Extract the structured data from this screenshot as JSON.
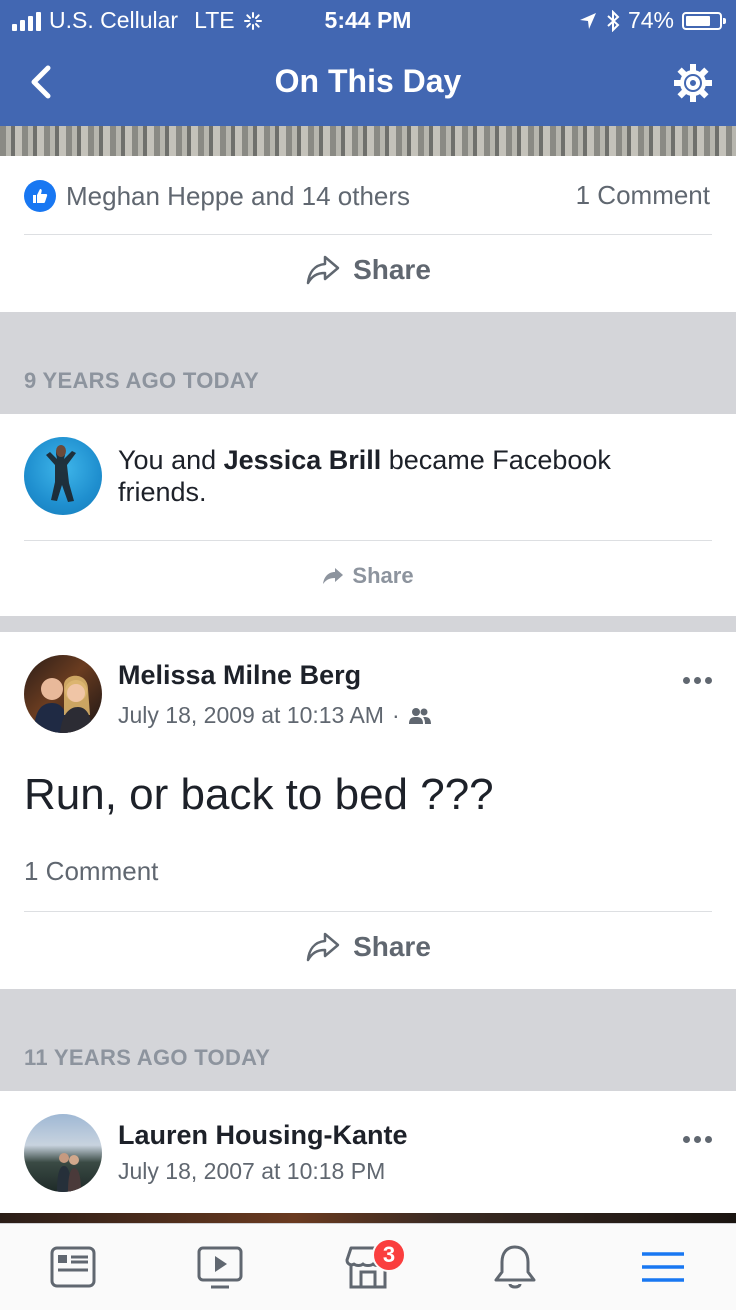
{
  "status_bar": {
    "carrier": "U.S. Cellular",
    "network": "LTE",
    "time": "5:44 PM",
    "battery_percent": "74%",
    "battery_level": 0.74
  },
  "navbar": {
    "title": "On This Day",
    "back_icon": "chevron-left-icon",
    "settings_icon": "gear-icon"
  },
  "post_top": {
    "reactions_text": "Meghan Heppe and 14 others",
    "comments": "1 Comment",
    "share_label": "Share"
  },
  "section_9_years": {
    "header": "9 YEARS AGO TODAY",
    "friend_prefix": "You and ",
    "friend_name": "Jessica Brill",
    "friend_suffix": " became Facebook friends.",
    "share_label": "Share"
  },
  "post_melissa": {
    "author": "Melissa Milne Berg",
    "timestamp": "July 18, 2009 at 10:13 AM",
    "separator": "·",
    "text": "Run, or back to bed ???",
    "comments": "1 Comment",
    "share_label": "Share"
  },
  "section_11_years": {
    "header": "11 YEARS AGO TODAY",
    "author": "Lauren Housing-Kante",
    "timestamp": "July 18, 2007 at 10:18 PM"
  },
  "tab_bar": {
    "tabs": [
      "news-feed-icon",
      "watch-icon",
      "marketplace-icon",
      "notifications-icon",
      "menu-icon"
    ],
    "marketplace_badge": "3"
  },
  "colors": {
    "brand": "#4267b2",
    "like_blue": "#1877f2",
    "badge_red": "#fa3e3e",
    "active_tab": "#1877f2"
  }
}
